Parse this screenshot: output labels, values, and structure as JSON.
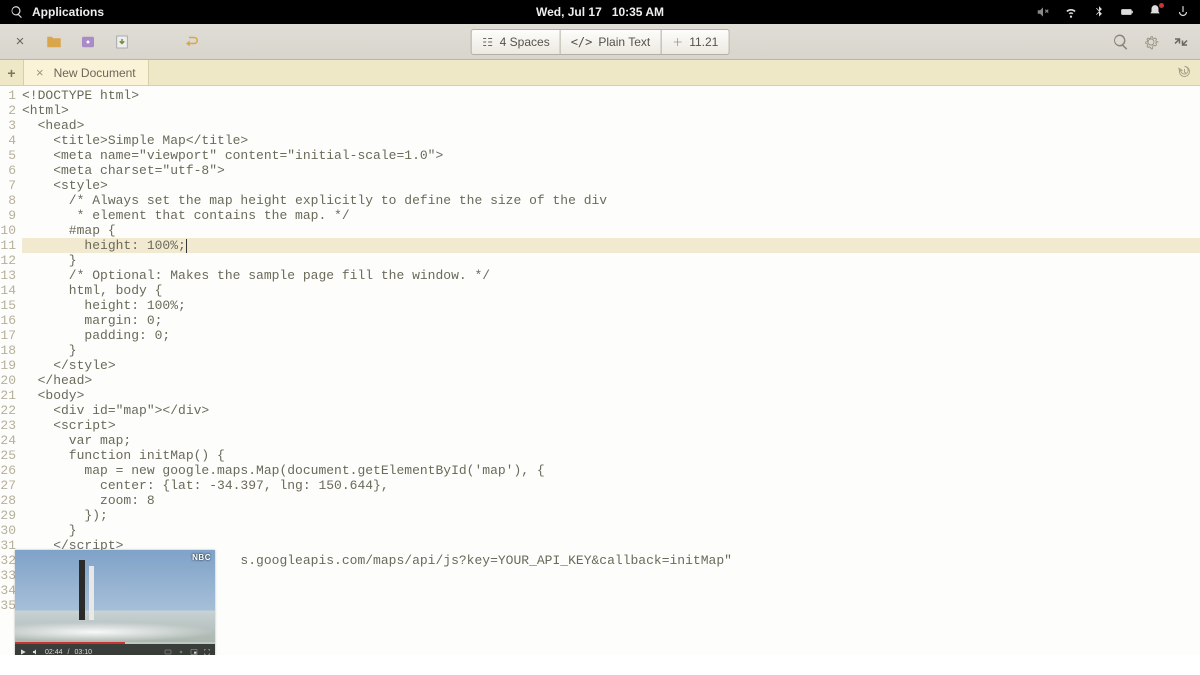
{
  "topbar": {
    "applications_label": "Applications",
    "date": "Wed, Jul 17",
    "time": "10:35 AM"
  },
  "toolbar": {
    "close_symbol": "×",
    "back_symbol": "↩",
    "spaces_label": "4 Spaces",
    "lang_label": "Plain Text",
    "cursor_label": "11.21"
  },
  "tab": {
    "title": "New Document",
    "close_symbol": "×",
    "add_symbol": "+"
  },
  "code": {
    "lines": [
      "<!DOCTYPE html>",
      "<html>",
      "  <head>",
      "    <title>Simple Map</title>",
      "    <meta name=\"viewport\" content=\"initial-scale=1.0\">",
      "    <meta charset=\"utf-8\">",
      "    <style>",
      "      /* Always set the map height explicitly to define the size of the div",
      "       * element that contains the map. */",
      "      #map {",
      "        height: 100%;",
      "      }",
      "      /* Optional: Makes the sample page fill the window. */",
      "      html, body {",
      "        height: 100%;",
      "        margin: 0;",
      "        padding: 0;",
      "      }",
      "    </style>",
      "  </head>",
      "  <body>",
      "    <div id=\"map\"></div>",
      "    <script>",
      "      var map;",
      "      function initMap() {",
      "        map = new google.maps.Map(document.getElementById('map'), {",
      "          center: {lat: -34.397, lng: 150.644},",
      "          zoom: 8",
      "        });",
      "      }",
      "    </script>",
      "                            s.googleapis.com/maps/api/js?key=YOUR_API_KEY&callback=initMap\"",
      "",
      "",
      ""
    ],
    "highlight_line": 11,
    "total_lines": 35
  },
  "pip": {
    "logo": "NBC",
    "time_elapsed": "02:44",
    "time_total": "03:10"
  }
}
